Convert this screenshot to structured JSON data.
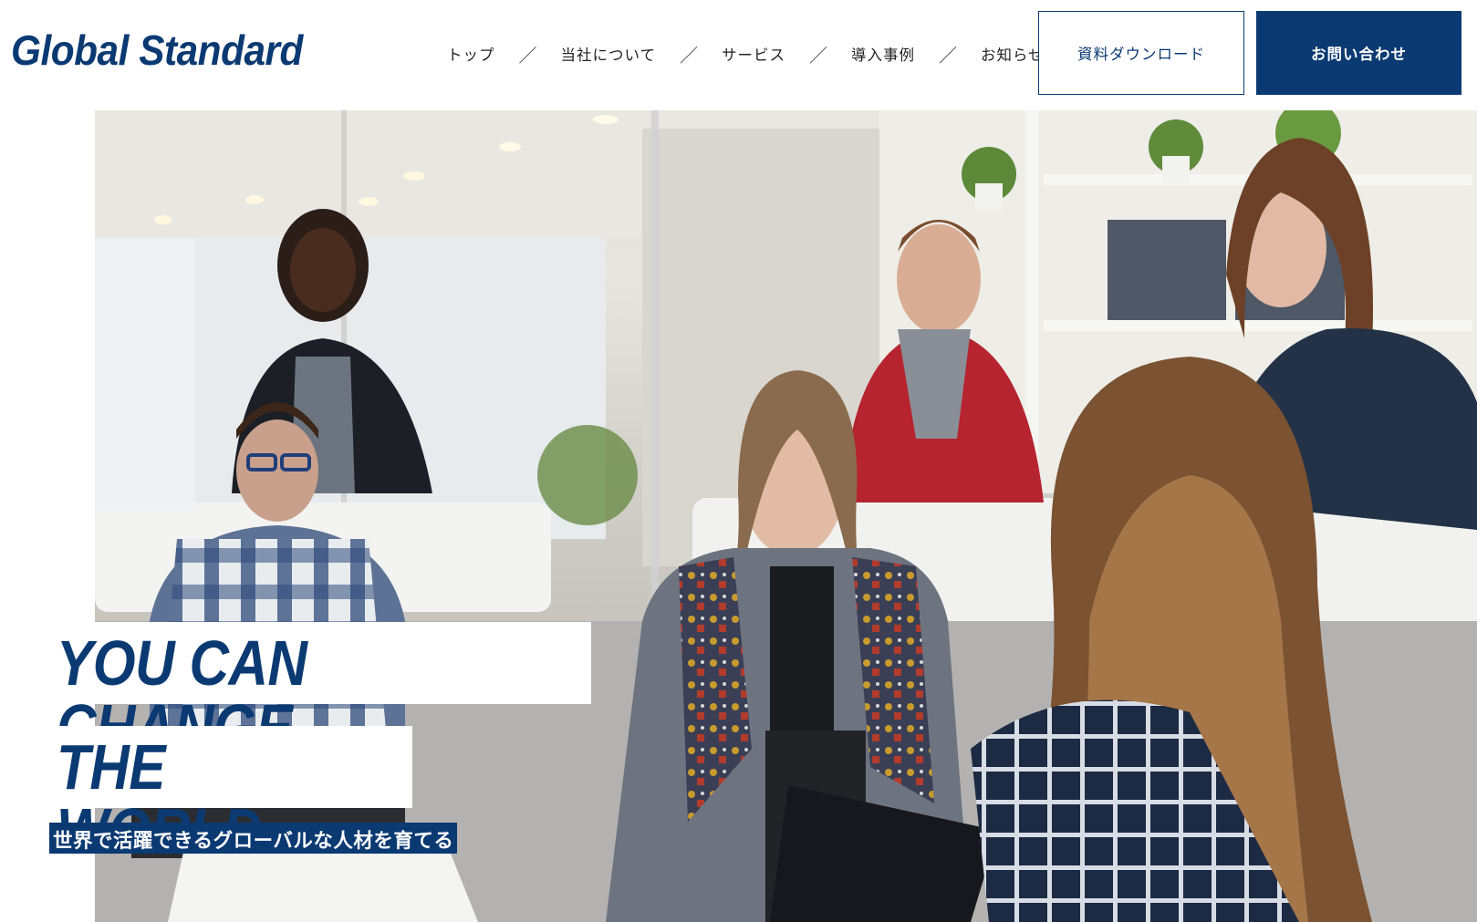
{
  "header": {
    "logo": "Global Standard",
    "nav": [
      "トップ",
      "当社について",
      "サービス",
      "導入事例",
      "お知らせ"
    ],
    "separator": "／",
    "download_button": "資料ダウンロード",
    "contact_button": "お問い合わせ"
  },
  "hero": {
    "image": "photo of a diverse group of young people in a meeting in a bright office",
    "headline_line1": "YOU CAN CHANGE",
    "headline_line2": "THE WORLD",
    "subheadline": "世界で活躍できるグローバルな人材を育てる"
  },
  "colors": {
    "brand": "#0b3a73",
    "background": "#ffffff"
  }
}
